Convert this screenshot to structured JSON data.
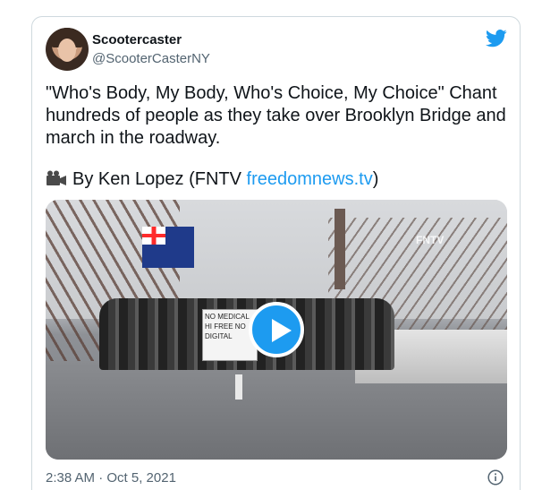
{
  "tweet": {
    "display_name": "Scootercaster",
    "handle": "@ScooterCasterNY",
    "text": "\"Who's Body, My Body, Who's Choice, My Choice\" Chant hundreds of people as they take over Brooklyn Bridge and march in the roadway.",
    "byline_prefix": "By Ken Lopez (FNTV ",
    "byline_link": "freedomnews.tv",
    "byline_suffix": ")",
    "timestamp": "2:38 AM · Oct 5, 2021"
  },
  "media": {
    "watermark": "FNTV",
    "sign_text": "NO MEDICAL HI FREE NO DIGITAL"
  },
  "icons": {
    "brand": "twitter-bird-icon",
    "byline": "video-camera-icon",
    "info": "info-icon",
    "play": "play-icon"
  },
  "colors": {
    "link": "#1d9bf0",
    "secondary_text": "#536471",
    "play_button": "#1d9bf0"
  }
}
